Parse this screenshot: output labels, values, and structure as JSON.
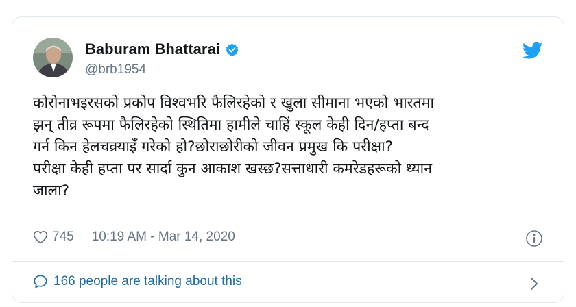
{
  "tweet": {
    "author_name": "Baburam Bhattarai",
    "author_handle": "@brb1954",
    "text": "कोरोनाभइरसको प्रकोप विश्वभरि फैलिरहेको र खुला सीमाना भएको भारतमा\nझन् तीव्र रूपमा फैलिरहेको स्थितिमा हामीले चाहिं स्कूल केही दिन/हप्ता बन्द\nगर्न किन हेलचक्र्याइँ गरेको हो?छोराछोरीको जीवन प्रमुख कि परीक्षा?\nपरीक्षा केही हप्ता पर सार्दा कुन आकाश खस्छ?सत्ताधारी कमरेडहरूको ध्यान\nजाला?",
    "likes": "745",
    "timestamp": "10:19 AM - Mar 14, 2020",
    "talking": "166 people are talking about this"
  },
  "icons": {
    "verified": "verified-badge-icon",
    "twitter": "twitter-bird-icon",
    "like": "heart-icon",
    "info": "info-icon",
    "conversation": "speech-bubble-icon",
    "chevron": "chevron-right-icon"
  },
  "colors": {
    "brand_blue": "#1da1f2",
    "text": "#14171a",
    "secondary": "#657786",
    "link": "#1b6ca8",
    "border": "#e1e8ed"
  }
}
